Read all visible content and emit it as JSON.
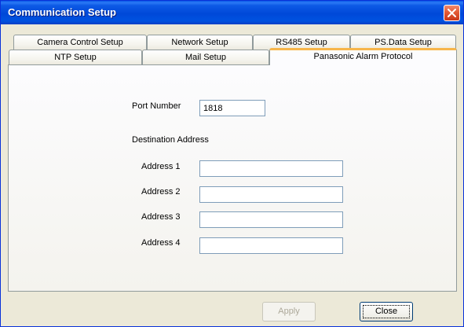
{
  "window": {
    "title": "Communication Setup"
  },
  "tabs": {
    "row_back": [
      "Camera Control Setup",
      "Network Setup",
      "RS485 Setup",
      "PS.Data Setup"
    ],
    "row_front": [
      "NTP Setup",
      "Mail Setup",
      "Panasonic Alarm Protocol"
    ],
    "active": "Panasonic Alarm Protocol"
  },
  "form": {
    "port_label": "Port Number",
    "port_value": "1818",
    "dest_label": "Destination Address",
    "addresses": [
      {
        "label": "Address 1",
        "value": ""
      },
      {
        "label": "Address 2",
        "value": ""
      },
      {
        "label": "Address 3",
        "value": ""
      },
      {
        "label": "Address 4",
        "value": ""
      }
    ]
  },
  "buttons": {
    "apply": "Apply",
    "close": "Close"
  },
  "icons": {
    "close": "close-x-icon"
  },
  "colors": {
    "titlebar": "#0048d8",
    "close_button": "#e35a35",
    "active_tab_accent": "#f7b64a"
  }
}
